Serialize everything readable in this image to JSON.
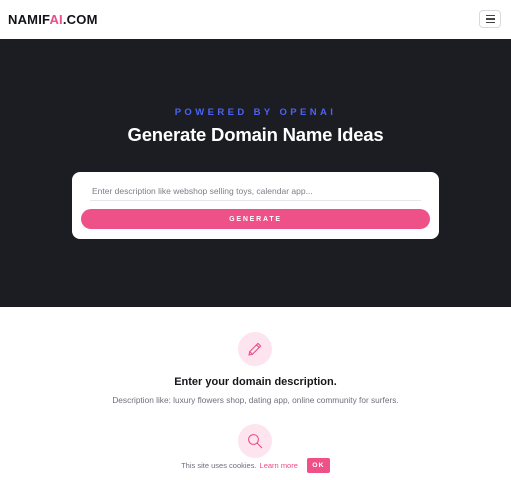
{
  "header": {
    "logo_prefix": "NAMIF",
    "logo_accent": "AI",
    "logo_suffix": ".COM",
    "menu_icon": "hamburger-menu-icon"
  },
  "hero": {
    "eyebrow": "POWERED BY OPENAI",
    "title": "Generate Domain Name Ideas",
    "input_placeholder": "Enter description like webshop selling toys, calendar app...",
    "input_value": "",
    "generate_label": "GENERATE"
  },
  "steps": [
    {
      "icon": "pencil-icon",
      "title": "Enter your domain description.",
      "text": "Description like: luxury flowers shop, dating app, online community for surfers."
    },
    {
      "icon": "search-icon"
    }
  ],
  "cookie_banner": {
    "text": "This site uses cookies.",
    "link_label": "Learn more",
    "ok_label": "OK"
  },
  "colors": {
    "accent_pink": "#ee5088",
    "eyebrow_blue": "#4b63f5",
    "hero_bg": "#1b1d22",
    "icon_circle_bg": "#fde4ee"
  }
}
